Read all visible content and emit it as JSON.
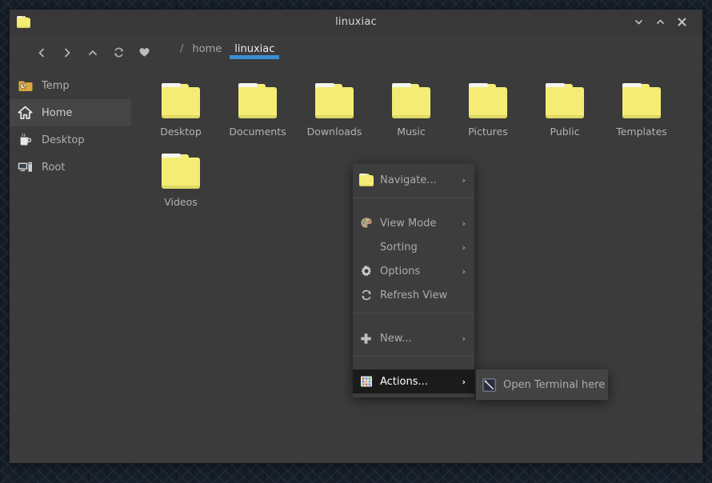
{
  "window": {
    "title": "linuxiac",
    "app_icon": "folder-icon",
    "controls": [
      {
        "name": "minimize-button",
        "glyph": "chevron-down-icon"
      },
      {
        "name": "maximize-button",
        "glyph": "chevron-up-icon"
      },
      {
        "name": "close-button",
        "glyph": "close-icon"
      }
    ]
  },
  "toolbar": {
    "buttons": [
      {
        "name": "back-button",
        "icon": "chevron-left-icon"
      },
      {
        "name": "forward-button",
        "icon": "chevron-right-icon"
      },
      {
        "name": "up-button",
        "icon": "chevron-up-icon"
      },
      {
        "name": "reload-button",
        "icon": "refresh-icon"
      },
      {
        "name": "bookmark-button",
        "icon": "heart-icon"
      }
    ],
    "breadcrumb": [
      {
        "label": "/",
        "active": false
      },
      {
        "label": "home",
        "active": false
      },
      {
        "label": "linuxiac",
        "active": true
      }
    ],
    "accent_color": "#3b8fd6"
  },
  "sidebar": {
    "items": [
      {
        "label": "Temp",
        "icon": "recent-folder-icon",
        "selected": false
      },
      {
        "label": "Home",
        "icon": "home-icon",
        "selected": true
      },
      {
        "label": "Desktop",
        "icon": "coffee-mug-icon",
        "selected": false
      },
      {
        "label": "Root",
        "icon": "computer-icon",
        "selected": false
      }
    ]
  },
  "files": [
    {
      "label": "Desktop",
      "icon": "folder-icon"
    },
    {
      "label": "Documents",
      "icon": "folder-icon"
    },
    {
      "label": "Downloads",
      "icon": "folder-icon"
    },
    {
      "label": "Music",
      "icon": "folder-icon"
    },
    {
      "label": "Pictures",
      "icon": "folder-icon"
    },
    {
      "label": "Public",
      "icon": "folder-icon"
    },
    {
      "label": "Templates",
      "icon": "folder-icon"
    },
    {
      "label": "Videos",
      "icon": "folder-icon"
    }
  ],
  "context_menu": {
    "items": [
      {
        "label": "Navigate...",
        "icon": "folder-icon",
        "arrow": "›",
        "highlight": false
      },
      {
        "label": "View Mode",
        "icon": "palette-icon",
        "arrow": "›",
        "highlight": false
      },
      {
        "label": "Sorting",
        "icon": "none",
        "arrow": "›",
        "highlight": false
      },
      {
        "label": "Options",
        "icon": "gear-icon",
        "arrow": "›",
        "highlight": false
      },
      {
        "label": "Refresh View",
        "icon": "refresh-icon",
        "arrow": "",
        "highlight": false
      },
      {
        "label": "New...",
        "icon": "plus-icon",
        "arrow": "›",
        "highlight": false
      },
      {
        "label": "Actions...",
        "icon": "apps-grid-icon",
        "arrow": "›",
        "highlight": true
      }
    ]
  },
  "submenu": {
    "items": [
      {
        "label": "Open Terminal here",
        "icon": "terminal-icon"
      }
    ]
  },
  "colors": {
    "window_bg": "#3b3b3b",
    "titlebar_bg": "#383838",
    "menu_bg": "#3d3d3d",
    "highlight_bg": "#1b1b1b",
    "folder_yellow": "#f4ec75",
    "accent_blue": "#3b8fd6",
    "desktop_bg": "#151e29"
  }
}
